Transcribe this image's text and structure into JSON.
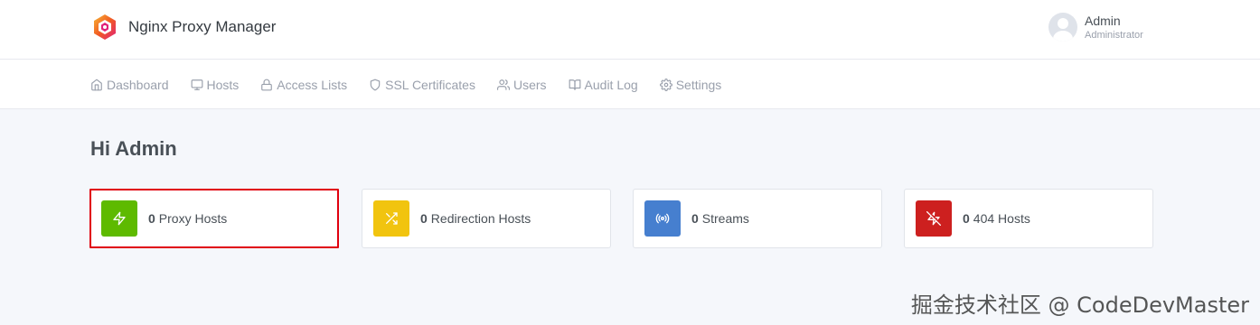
{
  "app": {
    "title": "Nginx Proxy Manager"
  },
  "user": {
    "name": "Admin",
    "role": "Administrator"
  },
  "nav": {
    "items": [
      {
        "label": "Dashboard",
        "icon": "home-icon"
      },
      {
        "label": "Hosts",
        "icon": "monitor-icon"
      },
      {
        "label": "Access Lists",
        "icon": "lock-icon"
      },
      {
        "label": "SSL Certificates",
        "icon": "shield-icon"
      },
      {
        "label": "Users",
        "icon": "users-icon"
      },
      {
        "label": "Audit Log",
        "icon": "book-icon"
      },
      {
        "label": "Settings",
        "icon": "gear-icon"
      }
    ]
  },
  "greeting": "Hi Admin",
  "stats": [
    {
      "count": "0",
      "label": "Proxy Hosts",
      "icon": "zap-icon",
      "color": "#5eba00",
      "highlighted": true
    },
    {
      "count": "0",
      "label": "Redirection Hosts",
      "icon": "shuffle-icon",
      "color": "#f1c40f",
      "highlighted": false
    },
    {
      "count": "0",
      "label": "Streams",
      "icon": "radio-icon",
      "color": "#467fcf",
      "highlighted": false
    },
    {
      "count": "0",
      "label": "404 Hosts",
      "icon": "zap-off-icon",
      "color": "#cd201f",
      "highlighted": false
    }
  ],
  "colors": {
    "highlight_border": "#e0000e",
    "background": "#f5f7fb"
  },
  "watermark": "掘金技术社区 @ CodeDevMaster"
}
